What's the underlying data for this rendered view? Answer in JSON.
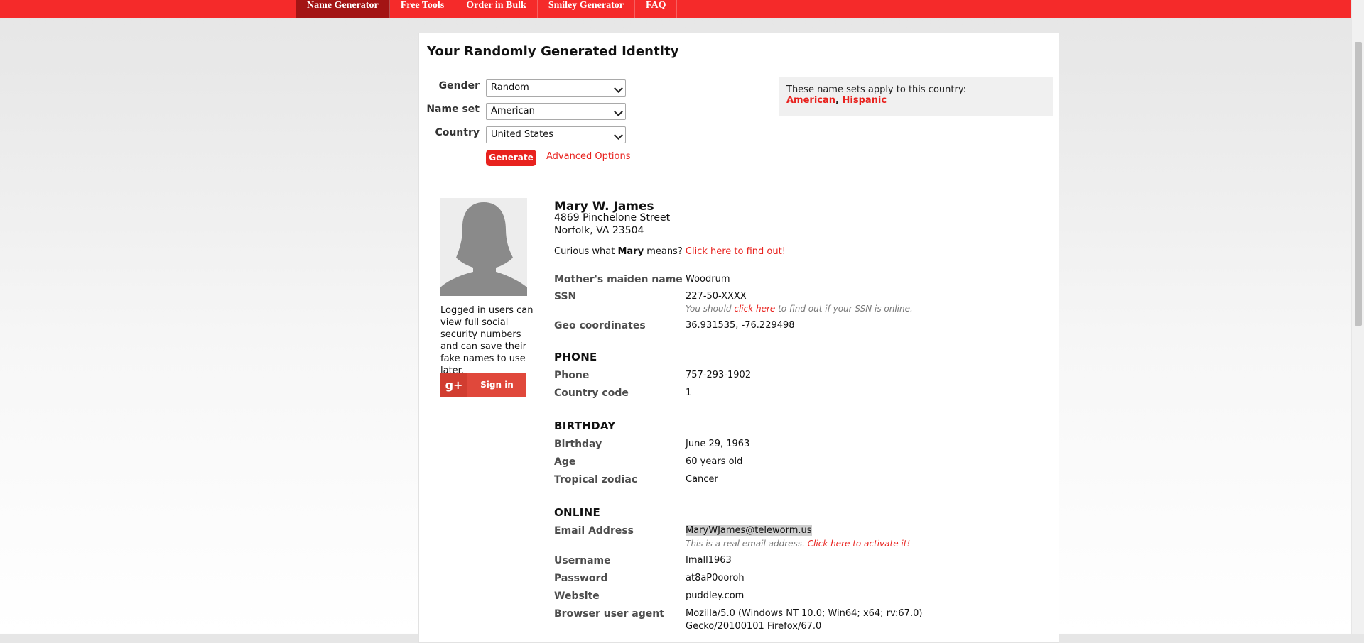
{
  "nav": {
    "items": [
      "Name Generator",
      "Free Tools",
      "Order in Bulk",
      "Smiley Generator",
      "FAQ"
    ]
  },
  "panel": {
    "title": "Your Randomly Generated Identity"
  },
  "form": {
    "gender": {
      "label": "Gender",
      "value": "Random"
    },
    "name_set": {
      "label": "Name set",
      "value": "American"
    },
    "country": {
      "label": "Country",
      "value": "United States"
    },
    "generate_label": "Generate",
    "advanced_label": "Advanced Options"
  },
  "notice": {
    "text": "These name sets apply to this country:",
    "set1": "American",
    "separator": ", ",
    "set2": "Hispanic"
  },
  "sidebar": {
    "login_text": "Logged in users can view full social security numbers and can save their fake names to use later.",
    "gplus_mark": "g+",
    "signin_label": "Sign in"
  },
  "identity": {
    "full_name": "Mary W. James",
    "street": "4869 Pinchelone Street",
    "city_line": "Norfolk, VA 23504",
    "curious_prefix": "Curious what ",
    "first_name": "Mary",
    "curious_suffix": " means? ",
    "curious_link": "Click here to find out!"
  },
  "details": {
    "maiden": {
      "label": "Mother's maiden name",
      "value": "Woodrum"
    },
    "ssn": {
      "label": "SSN",
      "value": "227-50-XXXX",
      "note_prefix": "You should ",
      "note_link": "click here",
      "note_suffix": " to find out if your SSN is online."
    },
    "geo": {
      "label": "Geo coordinates",
      "value": "36.931535, -76.229498"
    }
  },
  "phone_section": {
    "heading": "PHONE",
    "phone": {
      "label": "Phone",
      "value": "757-293-1902"
    },
    "country_code": {
      "label": "Country code",
      "value": "1"
    }
  },
  "birthday_section": {
    "heading": "BIRTHDAY",
    "birthday": {
      "label": "Birthday",
      "value": "June 29, 1963"
    },
    "age": {
      "label": "Age",
      "value": "60 years old"
    },
    "zodiac": {
      "label": "Tropical zodiac",
      "value": "Cancer"
    }
  },
  "online_section": {
    "heading": "ONLINE",
    "email": {
      "label": "Email Address",
      "value": "MaryWJames@teleworm.us",
      "note": "This is a real email address. ",
      "note_link": "Click here to activate it!"
    },
    "username": {
      "label": "Username",
      "value": "Imall1963"
    },
    "password": {
      "label": "Password",
      "value": "at8aP0ooroh"
    },
    "website": {
      "label": "Website",
      "value": "puddley.com"
    },
    "user_agent": {
      "label": "Browser user agent",
      "line1": "Mozilla/5.0 (Windows NT 10.0; Win64; x64; rv:67.0)",
      "line2": "Gecko/20100101 Firefox/67.0"
    }
  },
  "colors": {
    "brand_red": "#f52a2a",
    "active_nav": "#a31414",
    "link_red": "#e8221e"
  }
}
